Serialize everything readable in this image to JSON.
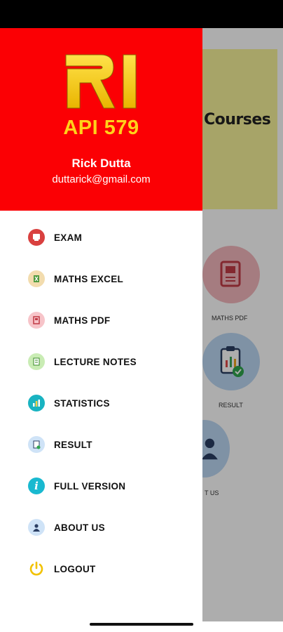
{
  "background_screen": {
    "banner_title": "Courses",
    "tile_labels": [
      "MATHS PDF",
      "RESULT",
      "T US"
    ]
  },
  "drawer": {
    "app_name": "API 579",
    "user_name": "Rick Dutta",
    "user_email": "duttarick@gmail.com",
    "header_color": "#fb0004",
    "logo_color": "#ffd21a",
    "menu": [
      {
        "label": "EXAM",
        "icon": "exam-icon"
      },
      {
        "label": "MATHS EXCEL",
        "icon": "excel-icon"
      },
      {
        "label": "MATHS PDF",
        "icon": "pdf-icon"
      },
      {
        "label": "LECTURE NOTES",
        "icon": "notes-icon"
      },
      {
        "label": "STATISTICS",
        "icon": "statistics-icon"
      },
      {
        "label": "RESULT",
        "icon": "result-icon"
      },
      {
        "label": "FULL VERSION",
        "icon": "info-icon"
      },
      {
        "label": "ABOUT US",
        "icon": "person-icon"
      },
      {
        "label": "LOGOUT",
        "icon": "power-icon"
      }
    ]
  }
}
